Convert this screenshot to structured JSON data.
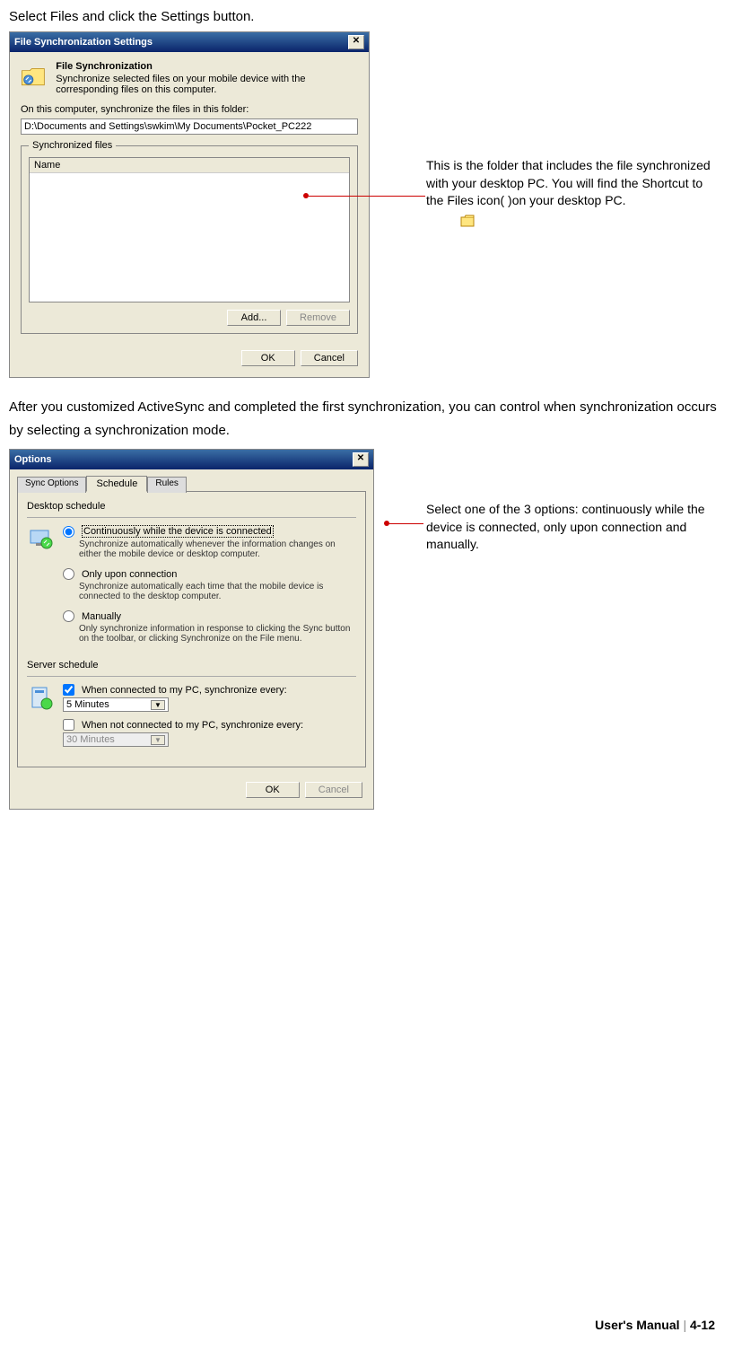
{
  "top_instruction": "Select Files and click the Settings button.",
  "dialog1": {
    "title": "File Synchronization Settings",
    "header_title": "File Synchronization",
    "header_desc": "Synchronize selected files on your mobile device with the corresponding files on this computer.",
    "folder_label": "On this computer, synchronize the files in this folder:",
    "folder_path": "D:\\Documents and Settings\\swkim\\My Documents\\Pocket_PC222",
    "fieldset_label": "Synchronized files",
    "list_header": "Name",
    "add_btn": "Add...",
    "remove_btn": "Remove",
    "ok_btn": "OK",
    "cancel_btn": "Cancel"
  },
  "callout1": "This is the folder that includes the file synchronized with your desktop PC. You will find the Shortcut to the Files icon(        )on your desktop PC.",
  "mid_paragraph": "After you customized ActiveSync and completed the first synchronization, you can control when synchronization occurs by selecting a synchronization mode.",
  "dialog2": {
    "title": "Options",
    "tabs": [
      "Sync Options",
      "Schedule",
      "Rules"
    ],
    "desktop_group": "Desktop schedule",
    "radio1_label": "Continuously while the device is connected",
    "radio1_desc": "Synchronize automatically whenever the information changes on either the mobile device or desktop computer.",
    "radio2_label": "Only upon connection",
    "radio2_desc": "Synchronize automatically each time that the mobile device is connected to the desktop computer.",
    "radio3_label": "Manually",
    "radio3_desc": "Only synchronize information in response to clicking the Sync button on the toolbar, or clicking Synchronize on the File menu.",
    "server_group": "Server schedule",
    "check1_label": "When connected to my PC, synchronize every:",
    "dropdown1": "5 Minutes",
    "check2_label": "When not connected to my PC, synchronize every:",
    "dropdown2": "30 Minutes",
    "ok_btn": "OK",
    "cancel_btn": "Cancel"
  },
  "callout2": "Select one of the 3 options: continuously while the device is connected, only upon connection and manually.",
  "footer_manual": "User's Manual",
  "footer_page": "4-12"
}
